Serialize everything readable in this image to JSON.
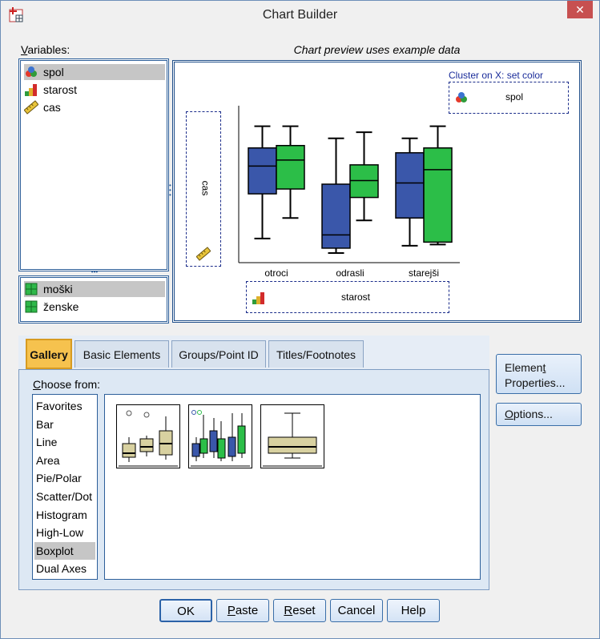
{
  "window": {
    "title": "Chart Builder",
    "close_label": "✕"
  },
  "variables": {
    "label": "Variables:",
    "items": [
      {
        "name": "spol",
        "icon": "nominal-icon",
        "selected": true
      },
      {
        "name": "starost",
        "icon": "ordinal-icon",
        "selected": false
      },
      {
        "name": "cas",
        "icon": "scale-icon",
        "selected": false
      }
    ],
    "categories": [
      {
        "name": "moški",
        "selected": true
      },
      {
        "name": "ženske",
        "selected": false
      }
    ]
  },
  "preview": {
    "caption": "Chart preview uses example data",
    "cluster_label": "Cluster on X: set color",
    "cluster_var": "spol",
    "y_var": "cas",
    "x_var": "starost"
  },
  "chart_data": {
    "type": "boxplot",
    "categories": [
      "otroci",
      "odrasli",
      "starejši"
    ],
    "series": [
      {
        "color": "#3a57aa",
        "boxes": [
          {
            "min": 2,
            "q1": 5.7,
            "median": 8,
            "q3": 9.5,
            "max": 11.3
          },
          {
            "min": 0.8,
            "q1": 1.2,
            "median": 2.3,
            "q3": 6.5,
            "max": 10.3
          },
          {
            "min": 1.4,
            "q1": 3.7,
            "median": 6.6,
            "q3": 9.1,
            "max": 10.3
          }
        ]
      },
      {
        "color": "#2cbe48",
        "boxes": [
          {
            "min": 3.7,
            "q1": 6.1,
            "median": 8.5,
            "q3": 9.7,
            "max": 11.3
          },
          {
            "min": 3.5,
            "q1": 5.4,
            "median": 6.8,
            "q3": 8.1,
            "max": 10.8
          },
          {
            "min": 1.5,
            "q1": 1.7,
            "median": 7.7,
            "q3": 9.5,
            "max": 11.3
          }
        ]
      }
    ],
    "ylim": [
      0,
      13
    ]
  },
  "tabs": [
    {
      "label": "Gallery",
      "active": true
    },
    {
      "label": "Basic Elements",
      "active": false
    },
    {
      "label": "Groups/Point ID",
      "active": false
    },
    {
      "label": "Titles/Footnotes",
      "active": false
    }
  ],
  "gallery": {
    "choose_label": "Choose from:",
    "types": [
      "Favorites",
      "Bar",
      "Line",
      "Area",
      "Pie/Polar",
      "Scatter/Dot",
      "Histogram",
      "High-Low",
      "Boxplot",
      "Dual Axes"
    ],
    "selected": "Boxplot"
  },
  "side_buttons": {
    "element_line1": "Element",
    "element_line2": "Properties...",
    "options": "Options..."
  },
  "buttons": {
    "ok": "OK",
    "paste": "Paste",
    "reset": "Reset",
    "cancel": "Cancel",
    "help": "Help"
  },
  "colors": {
    "male": "#3a57aa",
    "female": "#2cbe48",
    "thumb_box": "#d8d1a0",
    "accent_tab": "#f6c24e"
  }
}
